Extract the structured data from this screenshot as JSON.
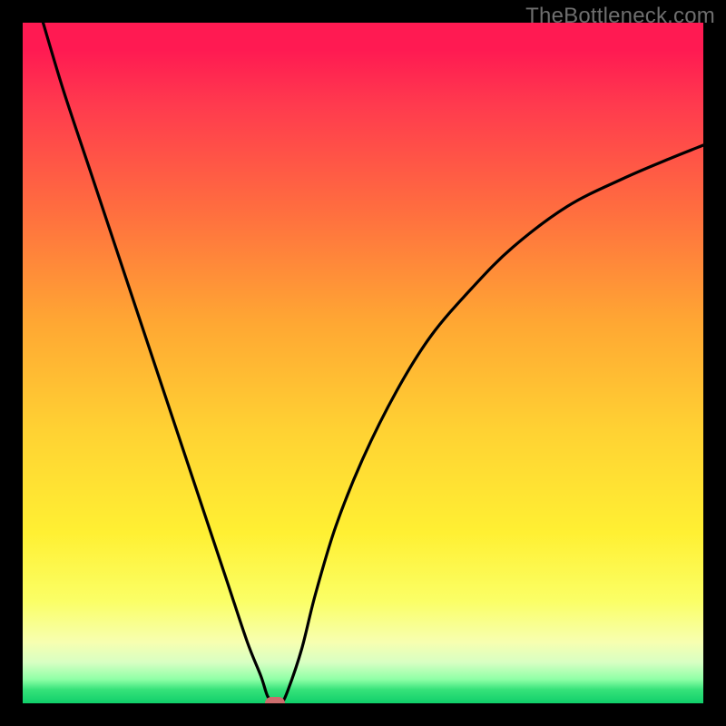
{
  "watermark": "TheBottleneck.com",
  "chart_data": {
    "type": "line",
    "title": "",
    "xlabel": "",
    "ylabel": "",
    "xlim": [
      0,
      100
    ],
    "ylim": [
      0,
      100
    ],
    "grid": false,
    "legend": false,
    "series": [
      {
        "name": "bottleneck-curve",
        "x": [
          3,
          6,
          10,
          14,
          18,
          22,
          26,
          30,
          33,
          35,
          36,
          37,
          38,
          39,
          41,
          43,
          46,
          50,
          55,
          60,
          66,
          72,
          80,
          88,
          95,
          100
        ],
        "y": [
          100,
          90,
          78,
          66,
          54,
          42,
          30,
          18,
          9,
          4,
          1,
          0,
          0,
          2,
          8,
          16,
          26,
          36,
          46,
          54,
          61,
          67,
          73,
          77,
          80,
          82
        ],
        "color": "#000000"
      }
    ],
    "marker": {
      "name": "optimal-point",
      "x": 37,
      "y": 0,
      "color": "#cc6d6d"
    },
    "background_gradient": {
      "orientation": "vertical",
      "stops": [
        {
          "pos": 0.0,
          "color": "#ff1a52"
        },
        {
          "pos": 0.12,
          "color": "#ff3a4e"
        },
        {
          "pos": 0.28,
          "color": "#ff6f3f"
        },
        {
          "pos": 0.44,
          "color": "#ffa733"
        },
        {
          "pos": 0.6,
          "color": "#ffd233"
        },
        {
          "pos": 0.75,
          "color": "#fff033"
        },
        {
          "pos": 0.85,
          "color": "#fbff66"
        },
        {
          "pos": 0.91,
          "color": "#f7ffb0"
        },
        {
          "pos": 0.94,
          "color": "#d8ffc3"
        },
        {
          "pos": 0.97,
          "color": "#8effa6"
        },
        {
          "pos": 0.98,
          "color": "#36e27a"
        },
        {
          "pos": 1.0,
          "color": "#10cf6a"
        }
      ]
    }
  }
}
